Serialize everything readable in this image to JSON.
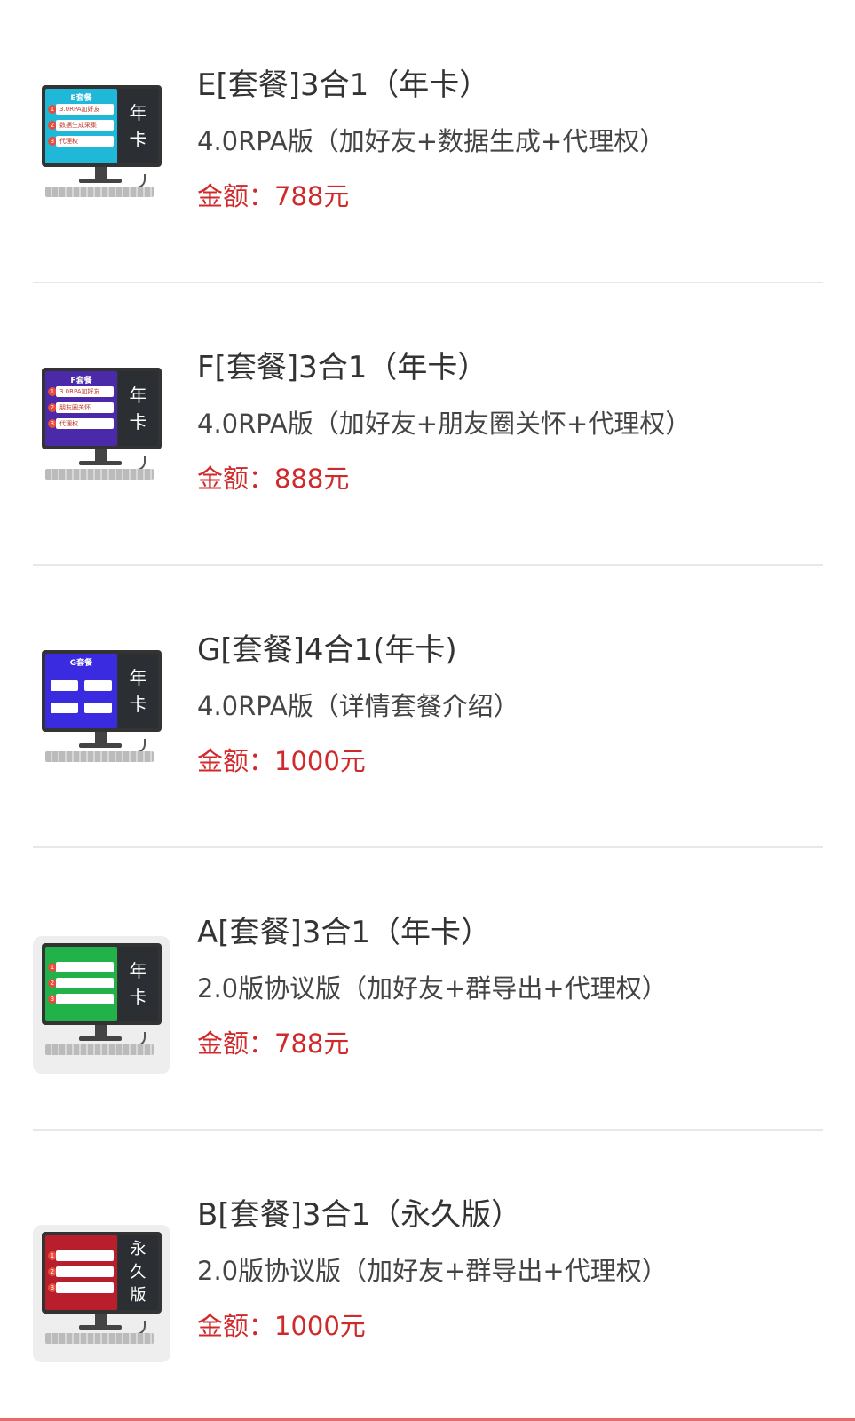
{
  "items": [
    {
      "title": "E[套餐]3合1（年卡）",
      "description": "4.0RPA版（加好友+数据生成+代理权）",
      "price": "金额：788元",
      "thumb": {
        "screen_title": "E套餐",
        "rows": [
          "3.0RPA加好友",
          "数据生成采集",
          "代理权"
        ],
        "side_label": [
          "年",
          "卡"
        ],
        "screen_color": "#1fb8d8",
        "boxed": false
      }
    },
    {
      "title": "F[套餐]3合1（年卡）",
      "description": "4.0RPA版（加好友+朋友圈关怀+代理权）",
      "price": "金额：888元",
      "thumb": {
        "screen_title": "F套餐",
        "rows": [
          "3.0RPA加好友",
          "朋友圈关怀",
          "代理权"
        ],
        "side_label": [
          "年",
          "卡"
        ],
        "screen_color": "#4a2aa8",
        "boxed": false
      }
    },
    {
      "title": "G[套餐]4合1(年卡)",
      "description": "4.0RPA版（详情套餐介绍）",
      "price": "金额：1000元",
      "thumb": {
        "screen_title": "G套餐",
        "rows": [
          "",
          "",
          ""
        ],
        "side_label": [
          "年",
          "卡"
        ],
        "screen_color": "#3a2ae0",
        "boxed": false
      }
    },
    {
      "title": "A[套餐]3合1（年卡）",
      "description": "2.0版协议版（加好友+群导出+代理权）",
      "price": "金额：788元",
      "thumb": {
        "screen_title": "",
        "rows": [
          "",
          "",
          ""
        ],
        "side_label": [
          "年",
          "卡"
        ],
        "screen_color": "#22b24a",
        "boxed": true
      }
    },
    {
      "title": "B[套餐]3合1（永久版）",
      "description": "2.0版协议版（加好友+群导出+代理权）",
      "price": "金额：1000元",
      "thumb": {
        "screen_title": "",
        "rows": [
          "",
          "",
          ""
        ],
        "side_label": [
          "永",
          "久",
          "版"
        ],
        "screen_color": "#b81e2b",
        "boxed": true
      }
    }
  ]
}
